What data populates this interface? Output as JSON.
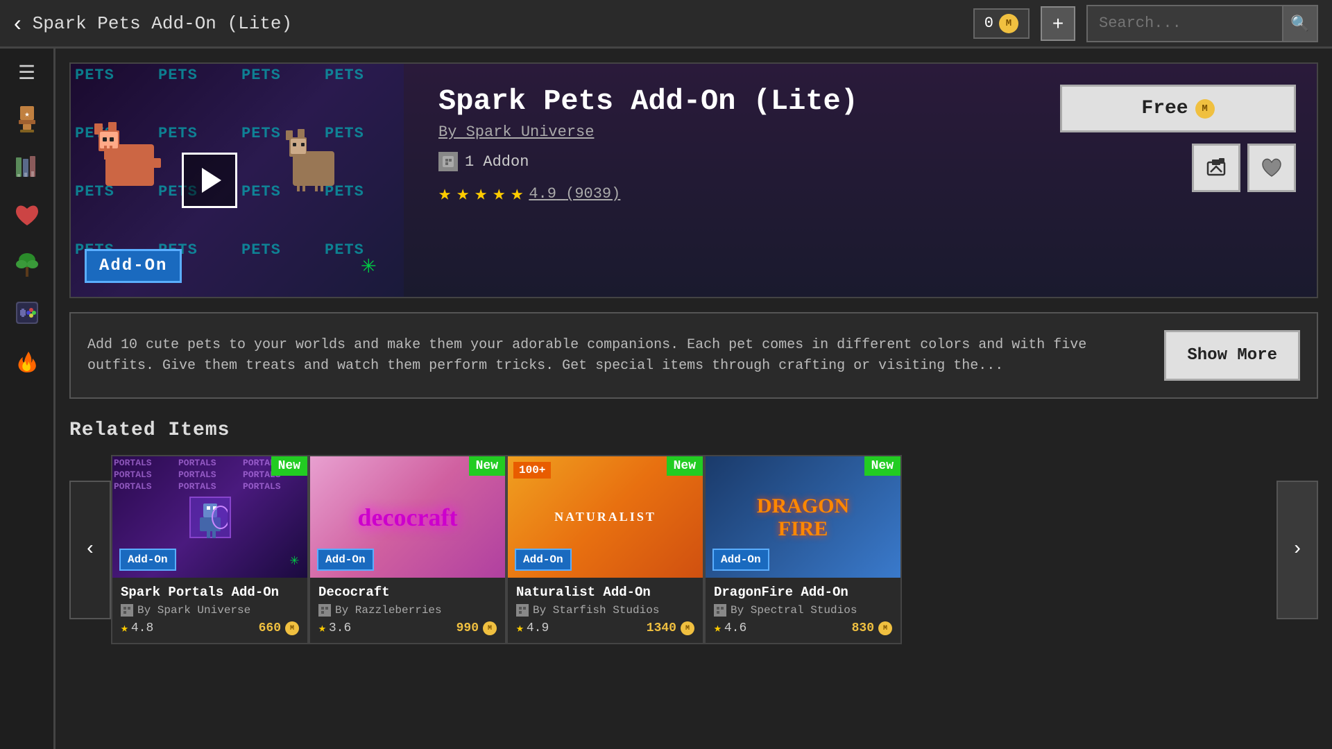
{
  "topbar": {
    "back_label": "‹",
    "title": "Spark Pets Add-On (Lite)",
    "coins": "0",
    "add_label": "+",
    "search_placeholder": "Search..."
  },
  "sidebar": {
    "menu_icon": "☰",
    "items": [
      {
        "icon": "🏆",
        "name": "achievements"
      },
      {
        "icon": "📚",
        "name": "library"
      },
      {
        "icon": "❤",
        "name": "favorites"
      },
      {
        "icon": "🌿",
        "name": "nature"
      },
      {
        "icon": "🎮",
        "name": "gaming"
      },
      {
        "icon": "🔥",
        "name": "fire"
      }
    ]
  },
  "product": {
    "title": "Spark Pets Add-On (Lite)",
    "author": "By Spark Universe",
    "addon_count": "1 Addon",
    "rating": "4.9",
    "rating_count": "(9039)",
    "price": "Free",
    "addon_label": "Add-On",
    "sparkle": "✳",
    "stars": 5
  },
  "description": {
    "text": "Add 10 cute pets to your worlds and make them your adorable companions. Each pet comes in different colors and with five outfits. Give them treats and watch them perform tricks. Get special items through crafting or visiting the...",
    "show_more": "Show More"
  },
  "related": {
    "title": "Related Items",
    "nav_left": "‹",
    "nav_right": "›",
    "items": [
      {
        "name": "Spark Portals Add-On",
        "author": "By Spark Universe",
        "rating": "4.8",
        "price": "660",
        "badge": "New",
        "has_hundred": false,
        "addon_label": "Add-On",
        "thumb_type": "portals"
      },
      {
        "name": "Decocraft",
        "author": "By Razzleberries",
        "rating": "3.6",
        "price": "990",
        "badge": "New",
        "has_hundred": false,
        "addon_label": "Add-On",
        "thumb_type": "deco"
      },
      {
        "name": "Naturalist Add-On",
        "author": "By Starfish Studios",
        "rating": "4.9",
        "price": "1340",
        "badge": "New",
        "has_hundred": true,
        "hundred_label": "100+",
        "addon_label": "Add-On",
        "thumb_type": "naturalist"
      },
      {
        "name": "DragonFire Add-On",
        "author": "By Spectral Studios",
        "rating": "4.6",
        "price": "830",
        "badge": "New",
        "has_hundred": false,
        "addon_label": "Add-On",
        "thumb_type": "dragon"
      }
    ]
  }
}
